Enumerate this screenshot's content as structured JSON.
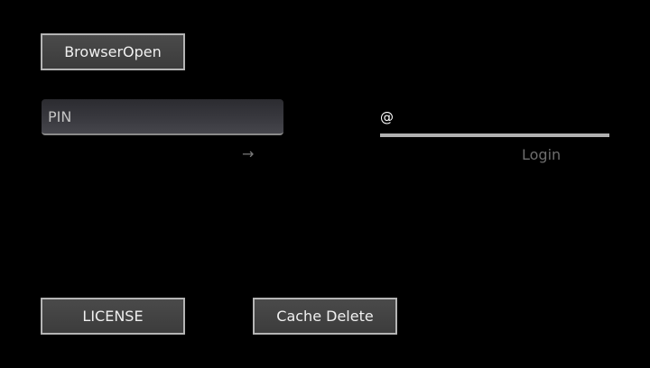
{
  "buttons": {
    "browser_open": "BrowserOpen",
    "license": "LICENSE",
    "cache_delete": "Cache Delete"
  },
  "pin": {
    "placeholder": "PIN",
    "value": ""
  },
  "pin_submit_arrow": "→",
  "email": {
    "placeholder": "@",
    "value": ""
  },
  "login_label": "Login",
  "colors": {
    "background": "#000000",
    "button_fill": "#444444",
    "button_border": "#b4b4b4",
    "button_text": "#f0f0f0",
    "disabled_text": "#6e6e6e"
  }
}
